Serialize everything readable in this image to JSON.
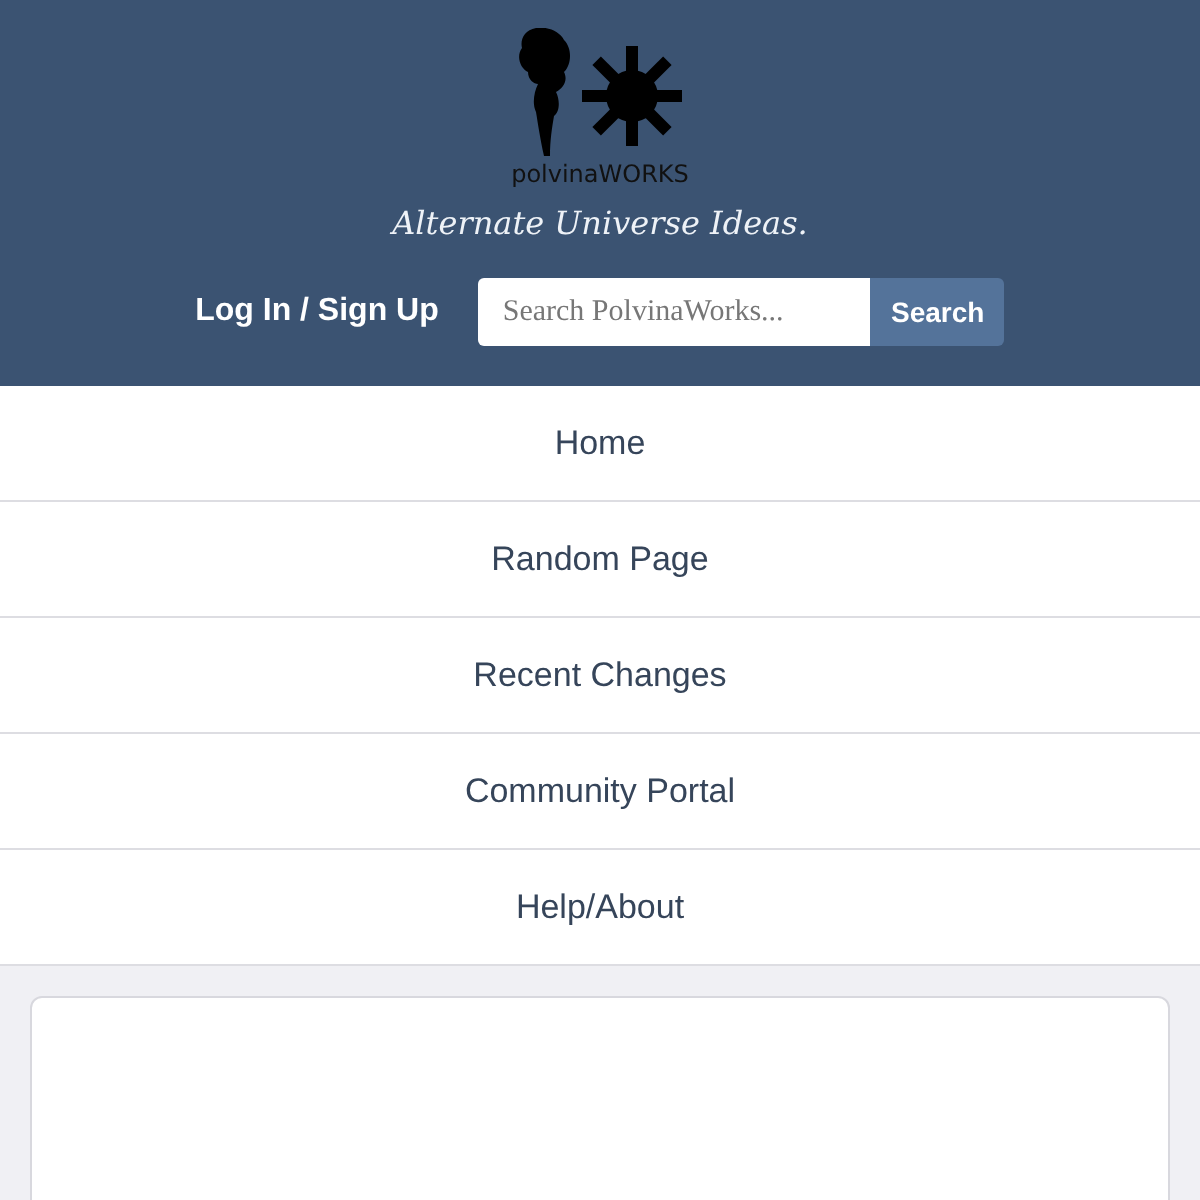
{
  "header": {
    "logo_text": "polvinaWORKS",
    "tagline": "Alternate Universe Ideas.",
    "login_link": "Log In / Sign Up",
    "search": {
      "placeholder": "Search PolvinaWorks..."
    },
    "search_button": "Search"
  },
  "nav": {
    "items": [
      {
        "label": "Home"
      },
      {
        "label": "Random Page"
      },
      {
        "label": "Recent Changes"
      },
      {
        "label": "Community Portal"
      },
      {
        "label": "Help/About"
      }
    ]
  }
}
